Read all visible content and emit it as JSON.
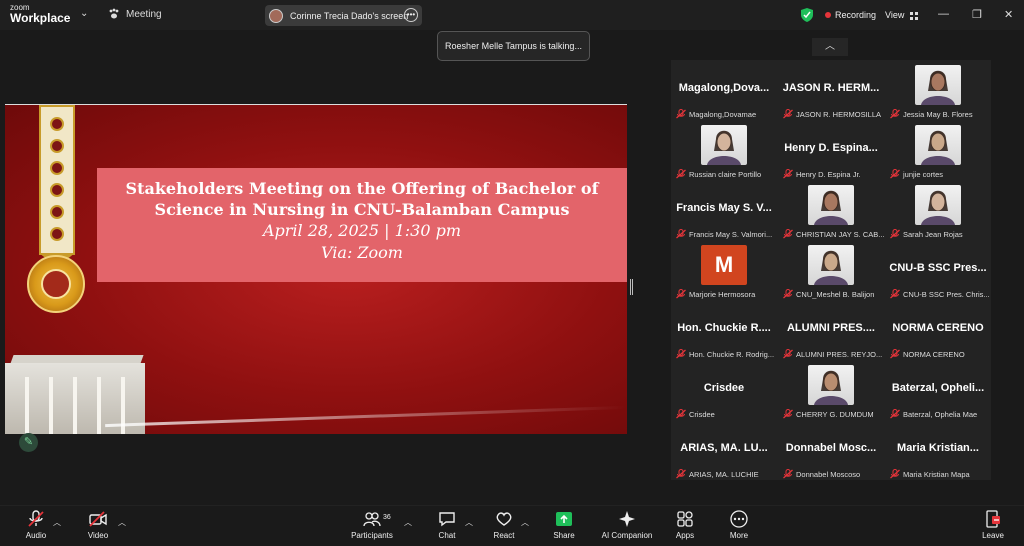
{
  "topbar": {
    "logo_small": "zoom",
    "logo_big": "Workplace",
    "meeting_label": "Meeting",
    "share_label": "Corinne Trecia Dado's screen",
    "recording_label": "Recording",
    "view_label": "View"
  },
  "toast": {
    "text": "Roesher Melle Tampus is talking..."
  },
  "slide": {
    "title_line1": "Stakeholders Meeting on the Offering of Bachelor of",
    "title_line2": "Science in Nursing in CNU-Balamban Campus",
    "date_line": "April 28, 2025 | 1:30 pm",
    "via_line": "Via: Zoom"
  },
  "gallery": {
    "tiles": [
      {
        "display": "Magalong,Dova...",
        "label": "Magalong,Dovamae",
        "has_photo": false
      },
      {
        "display": "JASON R. HERM...",
        "label": "JASON R. HERMOSILLA",
        "has_photo": false
      },
      {
        "display": "",
        "label": "Jessia May B. Flores",
        "has_photo": true
      },
      {
        "display": "",
        "label": "Russian claire Portillo",
        "has_photo": true
      },
      {
        "display": "Henry D. Espina...",
        "label": "Henry D. Espina Jr.",
        "has_photo": false
      },
      {
        "display": "",
        "label": "junjie cortes",
        "has_photo": true
      },
      {
        "display": "Francis May S. V...",
        "label": "Francis May S. Valmori...",
        "has_photo": false
      },
      {
        "display": "",
        "label": "CHRISTIAN JAY S. CAB...",
        "has_photo": true
      },
      {
        "display": "",
        "label": "Sarah Jean Rojas",
        "has_photo": true
      },
      {
        "display": "M",
        "label": "Marjorie Hermosora",
        "has_photo": true
      },
      {
        "display": "",
        "label": "CNU_Meshel B. Balijon",
        "has_photo": true
      },
      {
        "display": "CNU-B SSC Pres...",
        "label": "CNU-B SSC Pres. Chris...",
        "has_photo": false
      },
      {
        "display": "Hon. Chuckie R....",
        "label": "Hon. Chuckie R. Rodrig...",
        "has_photo": false
      },
      {
        "display": "ALUMNI PRES....",
        "label": "ALUMNI PRES. REYJO...",
        "has_photo": false
      },
      {
        "display": "NORMA CERENO",
        "label": "NORMA CERENO",
        "has_photo": false
      },
      {
        "display": "Crisdee",
        "label": "Crisdee",
        "has_photo": false
      },
      {
        "display": "",
        "label": "CHERRY G. DUMDUM",
        "has_photo": true
      },
      {
        "display": "Baterzal, Opheli...",
        "label": "Baterzal, Ophelia Mae",
        "has_photo": false
      },
      {
        "display": "ARIAS, MA. LU...",
        "label": "ARIAS, MA. LUCHIE",
        "has_photo": false
      },
      {
        "display": "Donnabel Mosc...",
        "label": "Donnabel Moscoso",
        "has_photo": false
      },
      {
        "display": "Maria Kristian...",
        "label": "Maria Kristian Mapa",
        "has_photo": false
      }
    ]
  },
  "toolbar": {
    "audio": "Audio",
    "video": "Video",
    "participants": "Participants",
    "participant_count": "36",
    "chat": "Chat",
    "react": "React",
    "share": "Share",
    "ai_companion": "AI Companion",
    "apps": "Apps",
    "more": "More",
    "leave": "Leave"
  },
  "colors": {
    "share_green": "#1fbf5a",
    "recording_red": "#e5343a",
    "slide_red": "#a51818",
    "title_box": "#e3646a",
    "leave_red": "#e5343a"
  }
}
